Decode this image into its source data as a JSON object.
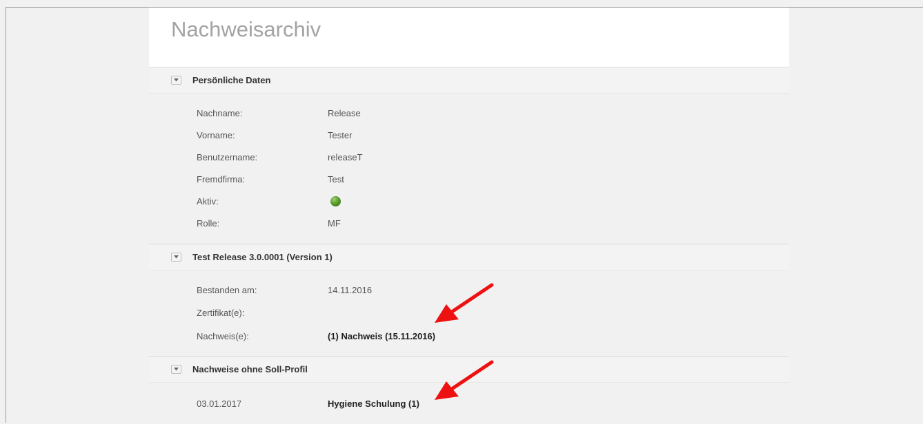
{
  "page": {
    "title": "Nachweisarchiv"
  },
  "personal": {
    "header": "Persönliche Daten",
    "fields": [
      {
        "label": "Nachname:",
        "value": "Release"
      },
      {
        "label": "Vorname:",
        "value": "Tester"
      },
      {
        "label": "Benutzername:",
        "value": "releaseT"
      },
      {
        "label": "Fremdfirma:",
        "value": "Test"
      },
      {
        "label": "Aktiv:",
        "value": ""
      },
      {
        "label": "Rolle:",
        "value": "MF"
      }
    ],
    "active_status_color": "#5a9e2c"
  },
  "release": {
    "header": "Test Release 3.0.0001 (Version 1)",
    "fields": [
      {
        "label": "Bestanden am:",
        "value": "14.11.2016"
      },
      {
        "label": "Zertifikat(e):",
        "value": ""
      },
      {
        "label": "Nachweis(e):",
        "value": "(1) Nachweis (15.11.2016)"
      }
    ]
  },
  "without_profile": {
    "header": "Nachweise ohne Soll-Profil",
    "rows": [
      {
        "date": "03.01.2017",
        "name": "Hygiene Schulung (1)"
      }
    ]
  },
  "annotation_color": "#ee1111"
}
